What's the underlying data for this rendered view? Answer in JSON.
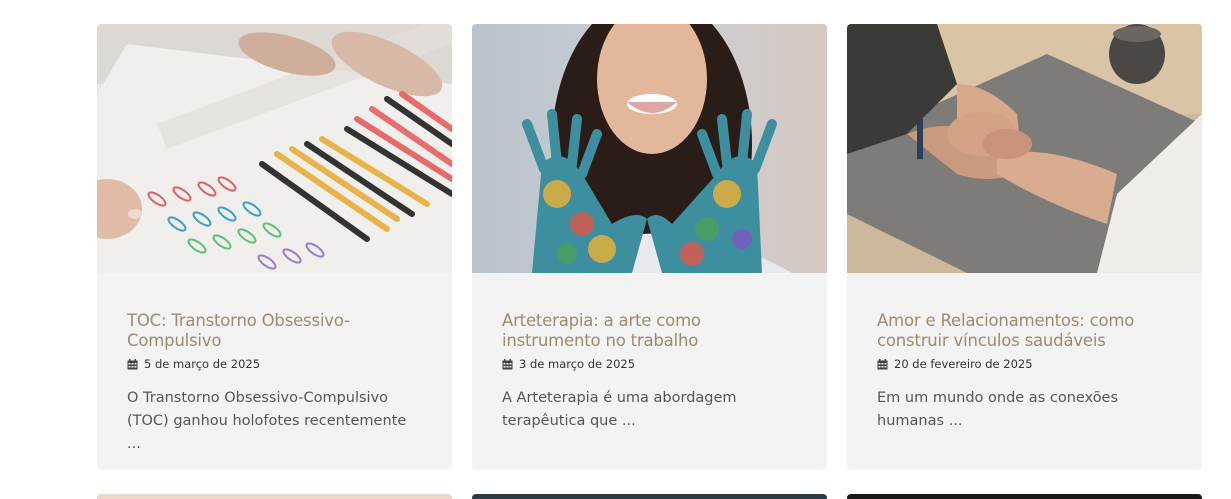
{
  "posts": [
    {
      "title": "TOC: Transtorno Obsessivo-Compulsivo",
      "date": "5 de março de 2025",
      "excerpt": "O Transtorno Obsessivo-Compulsivo (TOC) ganhou holofotes recentemente ...",
      "image_icon": "pens-and-clips-image"
    },
    {
      "title": "Arteterapia: a arte como instrumento no trabalho",
      "date": "3 de março de 2025",
      "excerpt": "A Arteterapia é uma abordagem terapêutica que ...",
      "image_icon": "painted-hands-heart-image"
    },
    {
      "title": "Amor e Relacionamentos: como construir vínculos saudáveis",
      "date": "20 de fevereiro de 2025",
      "excerpt": "Em um mundo onde as conexões humanas ...",
      "image_icon": "holding-hands-image"
    }
  ],
  "colors": {
    "title": "#a08a6c",
    "card_bg": "#f3f3f3",
    "text": "#555555"
  }
}
